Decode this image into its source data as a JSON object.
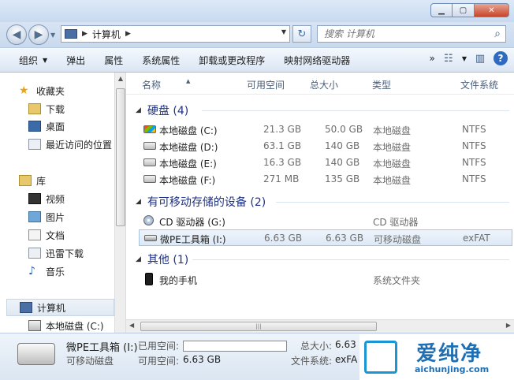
{
  "window": {
    "min": "▁",
    "max": "▢",
    "close": "✕"
  },
  "address": {
    "crumbs": [
      "计算机"
    ],
    "search_placeholder": "搜索 计算机"
  },
  "toolbar": {
    "items": [
      "组织",
      "弹出",
      "属性",
      "系统属性",
      "卸载或更改程序",
      "映射网络驱动器"
    ],
    "more": "»"
  },
  "nav": {
    "favorites": "收藏夹",
    "downloads": "下载",
    "desktop": "桌面",
    "recent": "最近访问的位置",
    "libraries": "库",
    "videos": "视频",
    "pictures": "图片",
    "documents": "文档",
    "xunlei": "迅雷下载",
    "music": "音乐",
    "computer": "计算机",
    "local_c": "本地磁盘 (C:)"
  },
  "columns": [
    "名称",
    "可用空间",
    "总大小",
    "类型",
    "文件系统"
  ],
  "groups": {
    "disks": "硬盘 (4)",
    "removable": "有可移动存储的设备 (2)",
    "other": "其他 (1)"
  },
  "disks": [
    {
      "name": "本地磁盘 (C:)",
      "free": "21.3 GB",
      "total": "50.0 GB",
      "type": "本地磁盘",
      "fs": "NTFS"
    },
    {
      "name": "本地磁盘 (D:)",
      "free": "63.1 GB",
      "total": "140 GB",
      "type": "本地磁盘",
      "fs": "NTFS"
    },
    {
      "name": "本地磁盘 (E:)",
      "free": "16.3 GB",
      "total": "140 GB",
      "type": "本地磁盘",
      "fs": "NTFS"
    },
    {
      "name": "本地磁盘 (F:)",
      "free": "271 MB",
      "total": "135 GB",
      "type": "本地磁盘",
      "fs": "NTFS"
    }
  ],
  "removable": [
    {
      "name": "CD 驱动器 (G:)",
      "type": "CD 驱动器"
    },
    {
      "name": "微PE工具箱 (I:)",
      "free": "6.63 GB",
      "total": "6.63 GB",
      "type": "可移动磁盘",
      "fs": "exFAT"
    }
  ],
  "other": [
    {
      "name": "我的手机",
      "type": "系统文件夹"
    }
  ],
  "details": {
    "name": "微PE工具箱 (I:)",
    "kind": "可移动磁盘",
    "used_label": "已用空间:",
    "free_label": "可用空间:",
    "free": "6.63 GB",
    "total_label": "总大小:",
    "total": "6.63",
    "fs_label": "文件系统:",
    "fs": "exFA",
    "used_fraction": 0.0
  },
  "watermark": {
    "title": "爱纯净",
    "url": "aichunjing.com"
  }
}
